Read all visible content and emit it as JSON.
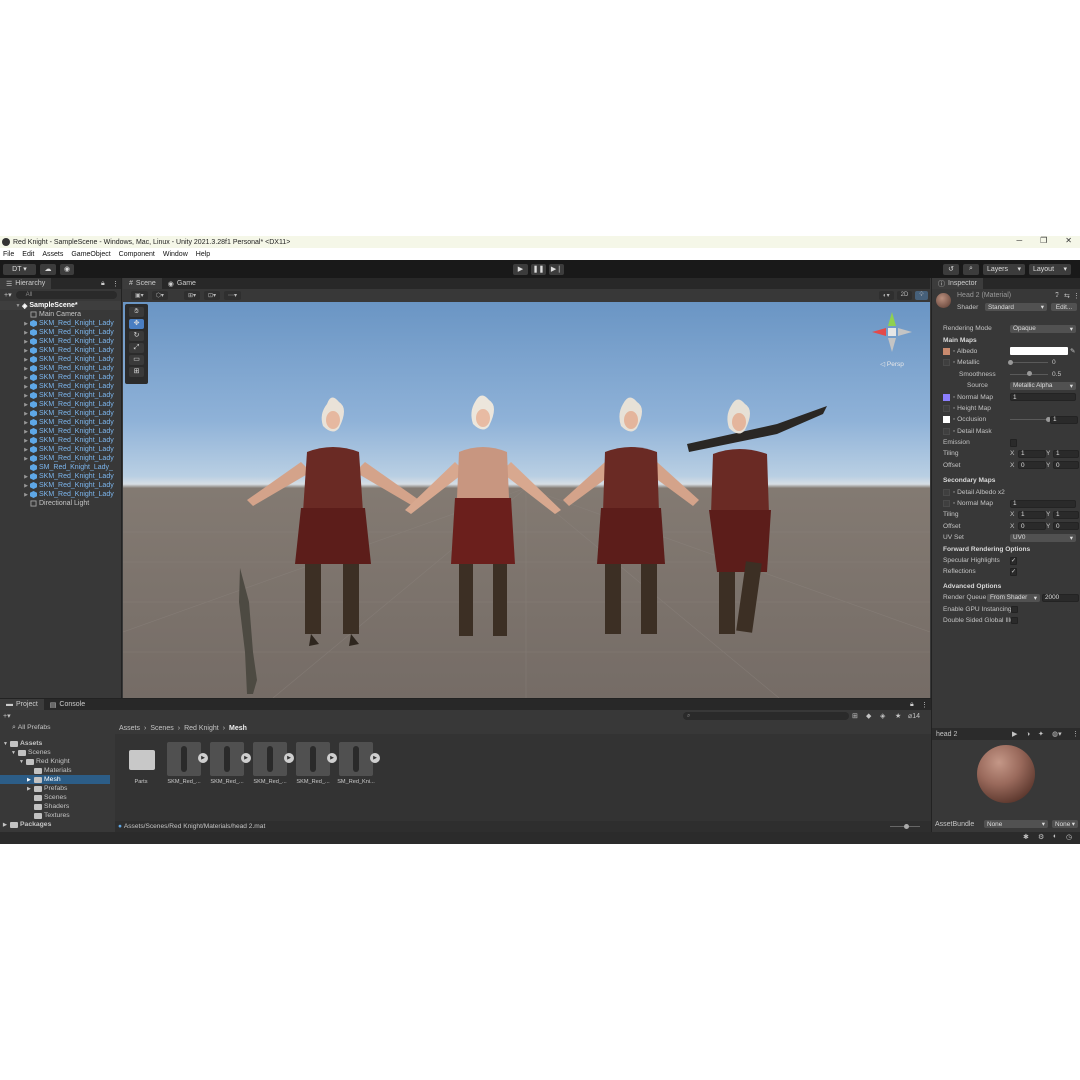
{
  "titlebar": {
    "title": "Red Knight - SampleScene - Windows, Mac, Linux - Unity 2021.3.28f1 Personal* <DX11>",
    "minimize": "─",
    "maximize": "❐",
    "close": "✕"
  },
  "menu": [
    "File",
    "Edit",
    "Assets",
    "GameObject",
    "Component",
    "Window",
    "Help"
  ],
  "toolbar": {
    "account": "DT ▾",
    "layers": "Layers",
    "layout": "Layout"
  },
  "hierarchy": {
    "tab": "Hierarchy",
    "search_placeholder": "All",
    "scene": "SampleScene*",
    "items": [
      {
        "label": "Main Camera",
        "kind": "grey",
        "arrow": ""
      },
      {
        "label": "SKM_Red_Knight_Lady",
        "kind": "blue",
        "arrow": "▶"
      },
      {
        "label": "SKM_Red_Knight_Lady",
        "kind": "blue",
        "arrow": "▶"
      },
      {
        "label": "SKM_Red_Knight_Lady",
        "kind": "blue",
        "arrow": "▶"
      },
      {
        "label": "SKM_Red_Knight_Lady",
        "kind": "blue",
        "arrow": "▶"
      },
      {
        "label": "SKM_Red_Knight_Lady",
        "kind": "blue",
        "arrow": "▶"
      },
      {
        "label": "SKM_Red_Knight_Lady",
        "kind": "blue",
        "arrow": "▶"
      },
      {
        "label": "SKM_Red_Knight_Lady",
        "kind": "blue",
        "arrow": "▶"
      },
      {
        "label": "SKM_Red_Knight_Lady",
        "kind": "blue",
        "arrow": "▶"
      },
      {
        "label": "SKM_Red_Knight_Lady",
        "kind": "blue",
        "arrow": "▶"
      },
      {
        "label": "SKM_Red_Knight_Lady",
        "kind": "blue",
        "arrow": "▶"
      },
      {
        "label": "SKM_Red_Knight_Lady",
        "kind": "blue",
        "arrow": "▶"
      },
      {
        "label": "SKM_Red_Knight_Lady",
        "kind": "blue",
        "arrow": "▶"
      },
      {
        "label": "SKM_Red_Knight_Lady",
        "kind": "blue",
        "arrow": "▶"
      },
      {
        "label": "SKM_Red_Knight_Lady",
        "kind": "blue",
        "arrow": "▶"
      },
      {
        "label": "SKM_Red_Knight_Lady",
        "kind": "blue",
        "arrow": "▶"
      },
      {
        "label": "SKM_Red_Knight_Lady",
        "kind": "blue",
        "arrow": "▶"
      },
      {
        "label": "SM_Red_Knight_Lady_",
        "kind": "blue",
        "arrow": ""
      },
      {
        "label": "SKM_Red_Knight_Lady",
        "kind": "blue",
        "arrow": "▶"
      },
      {
        "label": "SKM_Red_Knight_Lady",
        "kind": "blue",
        "arrow": "▶"
      },
      {
        "label": "SKM_Red_Knight_Lady",
        "kind": "blue",
        "arrow": "▶"
      },
      {
        "label": "Directional Light",
        "kind": "grey",
        "arrow": ""
      }
    ]
  },
  "scene": {
    "tab_scene": "Scene",
    "tab_game": "Game",
    "btn_2d": "2D",
    "persp": "◁ Persp"
  },
  "inspector": {
    "tab": "Inspector",
    "material_title": "Head 2 (Material)",
    "shader_label": "Shader",
    "shader_value": "Standard",
    "edit_button": "Edit...",
    "rendering_mode_label": "Rendering Mode",
    "rendering_mode_value": "Opaque",
    "main_maps": "Main Maps",
    "albedo": "Albedo",
    "metallic": "Metallic",
    "metallic_value": "0",
    "metallic_level": 0.0,
    "smoothness": "Smoothness",
    "smoothness_value": "0.5",
    "smoothness_level": 0.5,
    "source": "Source",
    "source_value": "Metallic Alpha",
    "normal_map": "Normal Map",
    "normal_map_value": "1",
    "height_map": "Height Map",
    "occlusion": "Occlusion",
    "occlusion_value": "1",
    "occlusion_level": 1.0,
    "detail_mask": "Detail Mask",
    "emission": "Emission",
    "tiling": "Tiling",
    "offset": "Offset",
    "x": "X",
    "y": "Y",
    "tiling_x": "1",
    "tiling_y": "1",
    "offset_x": "0",
    "offset_y": "0",
    "secondary_maps": "Secondary Maps",
    "detail_albedo": "Detail Albedo x2",
    "sec_normal_map": "Normal Map",
    "sec_normal_value": "1",
    "sec_tiling_x": "1",
    "sec_tiling_y": "1",
    "sec_offset_x": "0",
    "sec_offset_y": "0",
    "uv_set": "UV Set",
    "uv_set_value": "UV0",
    "forward_options": "Forward Rendering Options",
    "specular_highlights": "Specular Highlights",
    "reflections": "Reflections",
    "advanced_options": "Advanced Options",
    "render_queue": "Render Queue",
    "render_queue_mode": "From Shader",
    "render_queue_value": "2000",
    "gpu_instancing": "Enable GPU Instancing",
    "double_sided": "Double Sided Global Illumination",
    "preview_title": "head 2",
    "assetbundle_label": "AssetBundle",
    "assetbundle_value": "None",
    "assetbundle_variant": "None",
    "colors": {
      "albedo_swatch": "#c98a6e",
      "normal_swatch": "#8c7fff",
      "occlusion_swatch": "#ffffff"
    }
  },
  "project": {
    "tab_project": "Project",
    "tab_console": "Console",
    "all_prefabs": "All Prefabs",
    "tree": [
      {
        "label": "Assets",
        "indent": 0,
        "bold": true,
        "arrow": "▼"
      },
      {
        "label": "Scenes",
        "indent": 1,
        "bold": false,
        "arrow": "▼"
      },
      {
        "label": "Red Knight",
        "indent": 2,
        "bold": false,
        "arrow": "▼"
      },
      {
        "label": "Materials",
        "indent": 3,
        "bold": false,
        "arrow": ""
      },
      {
        "label": "Mesh",
        "indent": 3,
        "bold": false,
        "arrow": "▶",
        "selected": true
      },
      {
        "label": "Prefabs",
        "indent": 3,
        "bold": false,
        "arrow": "▶"
      },
      {
        "label": "Scenes",
        "indent": 3,
        "bold": false,
        "arrow": ""
      },
      {
        "label": "Shaders",
        "indent": 3,
        "bold": false,
        "arrow": ""
      },
      {
        "label": "Textures",
        "indent": 3,
        "bold": false,
        "arrow": ""
      },
      {
        "label": "Packages",
        "indent": 0,
        "bold": true,
        "arrow": "▶"
      }
    ],
    "breadcrumb": [
      "Assets",
      "Scenes",
      "Red Knight",
      "Mesh"
    ],
    "assets": [
      {
        "label": "Parts",
        "folder": true
      },
      {
        "label": "SKM_Red_...",
        "folder": false
      },
      {
        "label": "SKM_Red_...",
        "folder": false
      },
      {
        "label": "SKM_Red_...",
        "folder": false
      },
      {
        "label": "SKM_Red_...",
        "folder": false
      },
      {
        "label": "SM_Red_Kni...",
        "folder": false
      }
    ],
    "hidden_count": "14",
    "path": "Assets/Scenes/Red Knight/Materials/head 2.mat"
  }
}
